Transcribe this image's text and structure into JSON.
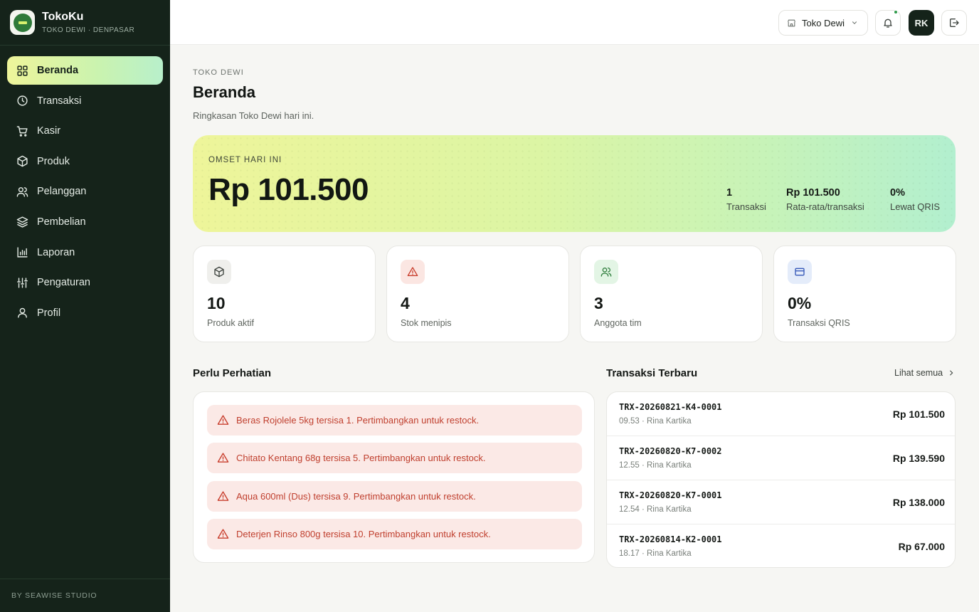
{
  "brand": {
    "name": "TokoKu",
    "subtitle": "TOKO DEWI · DENPASAR"
  },
  "nav": [
    {
      "label": "Beranda",
      "icon": "grid-icon",
      "active": true
    },
    {
      "label": "Transaksi",
      "icon": "clock-icon"
    },
    {
      "label": "Kasir",
      "icon": "cart-icon"
    },
    {
      "label": "Produk",
      "icon": "box-icon"
    },
    {
      "label": "Pelanggan",
      "icon": "users-icon"
    },
    {
      "label": "Pembelian",
      "icon": "layers-icon"
    },
    {
      "label": "Laporan",
      "icon": "bar-chart-icon"
    },
    {
      "label": "Pengaturan",
      "icon": "sliders-icon"
    },
    {
      "label": "Profil",
      "icon": "user-icon"
    }
  ],
  "footer": "BY SEAWISE STUDIO",
  "topbar": {
    "store": "Toko Dewi",
    "avatar": "RK"
  },
  "header": {
    "eyebrow": "TOKO DEWI",
    "title": "Beranda",
    "subtitle": "Ringkasan Toko Dewi hari ini."
  },
  "hero": {
    "label": "OMSET HARI INI",
    "value": "Rp 101.500",
    "stats": [
      {
        "value": "1",
        "label": "Transaksi"
      },
      {
        "value": "Rp 101.500",
        "label": "Rata-rata/transaksi"
      },
      {
        "value": "0%",
        "label": "Lewat QRIS"
      }
    ]
  },
  "cards": [
    {
      "value": "10",
      "label": "Produk aktif",
      "icon": "box-icon"
    },
    {
      "value": "4",
      "label": "Stok menipis",
      "icon": "warning-icon"
    },
    {
      "value": "3",
      "label": "Anggota tim",
      "icon": "users-icon"
    },
    {
      "value": "0%",
      "label": "Transaksi QRIS",
      "icon": "card-icon"
    }
  ],
  "attention": {
    "title": "Perlu Perhatian",
    "items": [
      "Beras Rojolele 5kg tersisa 1. Pertimbangkan untuk restock.",
      "Chitato Kentang 68g tersisa 5. Pertimbangkan untuk restock.",
      "Aqua 600ml (Dus) tersisa 9. Pertimbangkan untuk restock.",
      "Deterjen Rinso 800g tersisa 10. Pertimbangkan untuk restock."
    ]
  },
  "transactions": {
    "title": "Transaksi Terbaru",
    "see_all": "Lihat semua",
    "rows": [
      {
        "id": "TRX-20260821-K4-0001",
        "meta": "09.53 · Rina Kartika",
        "amount": "Rp 101.500"
      },
      {
        "id": "TRX-20260820-K7-0002",
        "meta": "12.55 · Rina Kartika",
        "amount": "Rp 139.590"
      },
      {
        "id": "TRX-20260820-K7-0001",
        "meta": "12.54 · Rina Kartika",
        "amount": "Rp 138.000"
      },
      {
        "id": "TRX-20260814-K2-0001",
        "meta": "18.17 · Rina Kartika",
        "amount": "Rp 67.000"
      }
    ]
  }
}
